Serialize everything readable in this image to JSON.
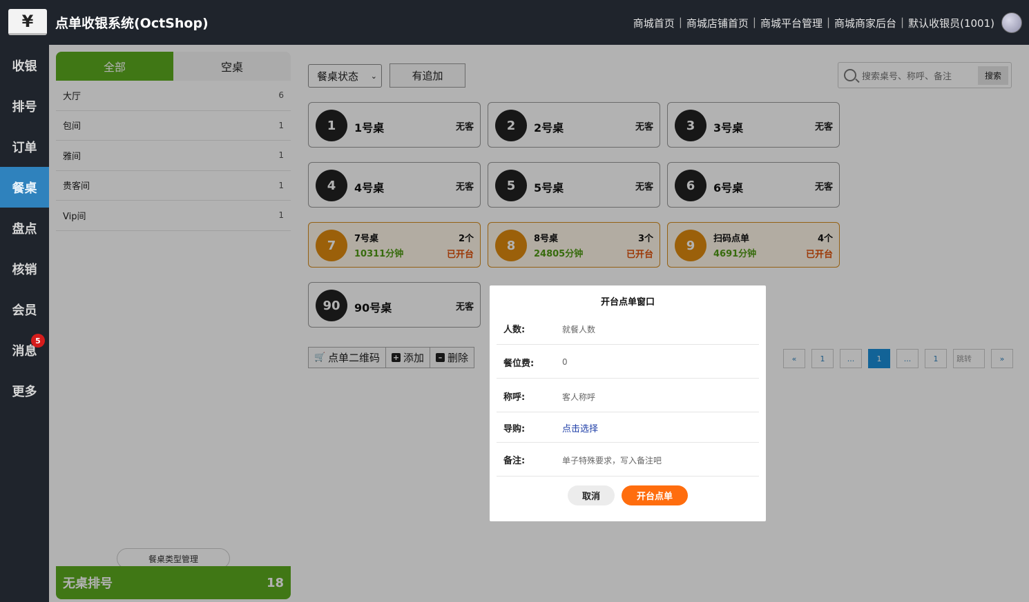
{
  "header": {
    "logo_glyph": "¥",
    "title": "点单收银系统(OctShop)",
    "nav": [
      "商城首页",
      "商城店铺首页",
      "商城平台管理",
      "商城商家后台",
      "默认收银员(1001)"
    ]
  },
  "leftnav": [
    {
      "label": "收银",
      "active": false
    },
    {
      "label": "排号",
      "active": false
    },
    {
      "label": "订单",
      "active": false
    },
    {
      "label": "餐桌",
      "active": true
    },
    {
      "label": "盘点",
      "active": false
    },
    {
      "label": "核销",
      "active": false
    },
    {
      "label": "会员",
      "active": false
    },
    {
      "label": "消息",
      "active": false,
      "badge": "5"
    },
    {
      "label": "更多",
      "active": false
    }
  ],
  "category_panel": {
    "tabs": [
      "全部",
      "空桌"
    ],
    "categories": [
      {
        "name": "大厅",
        "count": "6"
      },
      {
        "name": "包间",
        "count": "1"
      },
      {
        "name": "雅间",
        "count": "1"
      },
      {
        "name": "贵客间",
        "count": "1"
      },
      {
        "name": "Vip间",
        "count": "1"
      }
    ],
    "manage_label": "餐桌类型管理",
    "queue_label": "无桌排号",
    "queue_count": "18"
  },
  "filters": {
    "status_select": "餐桌状态",
    "added_button": "有追加",
    "search_placeholder": "搜索桌号、称呼、备注",
    "search_button": "搜索"
  },
  "tables": [
    {
      "num": "1",
      "name": "1号桌",
      "status": "无客",
      "open": false
    },
    {
      "num": "2",
      "name": "2号桌",
      "status": "无客",
      "open": false
    },
    {
      "num": "3",
      "name": "3号桌",
      "status": "无客",
      "open": false
    },
    {
      "num": "4",
      "name": "4号桌",
      "status": "无客",
      "open": false
    },
    {
      "num": "5",
      "name": "5号桌",
      "status": "无客",
      "open": false
    },
    {
      "num": "6",
      "name": "6号桌",
      "status": "无客",
      "open": false
    },
    {
      "num": "7",
      "name": "7号桌",
      "count": "2个",
      "time": "10311分钟",
      "status": "已开台",
      "open": true
    },
    {
      "num": "8",
      "name": "8号桌",
      "count": "3个",
      "time": "24805分钟",
      "status": "已开台",
      "open": true
    },
    {
      "num": "9",
      "name": "扫码点单",
      "count": "4个",
      "time": "4691分钟",
      "status": "已开台",
      "open": true
    },
    {
      "num": "90",
      "name": "90号桌",
      "status": "无客",
      "open": false
    }
  ],
  "toolbar": {
    "qr_label": "点单二维码",
    "add_label": "添加",
    "delete_label": "删除"
  },
  "pager": [
    "«",
    "1",
    "...",
    "1",
    "...",
    "1",
    "跳转",
    "»"
  ],
  "pager_active_index": 3,
  "modal": {
    "title": "开台点单窗口",
    "rows": [
      {
        "label": "人数:",
        "value": "就餐人数"
      },
      {
        "label": "餐位费:",
        "value": "0"
      },
      {
        "label": "称呼:",
        "value": "客人称呼"
      },
      {
        "label": "导购:",
        "value": "点击选择"
      },
      {
        "label": "备注:",
        "value": "单子特殊要求，写入备注吧"
      }
    ],
    "cancel_label": "取消",
    "open_label": "开台点单"
  },
  "colors": {
    "accent_green": "#5cab1f",
    "nav_active": "#2f82bd",
    "open_orange": "#ff6d0e",
    "badge_red": "#d61c1c"
  }
}
